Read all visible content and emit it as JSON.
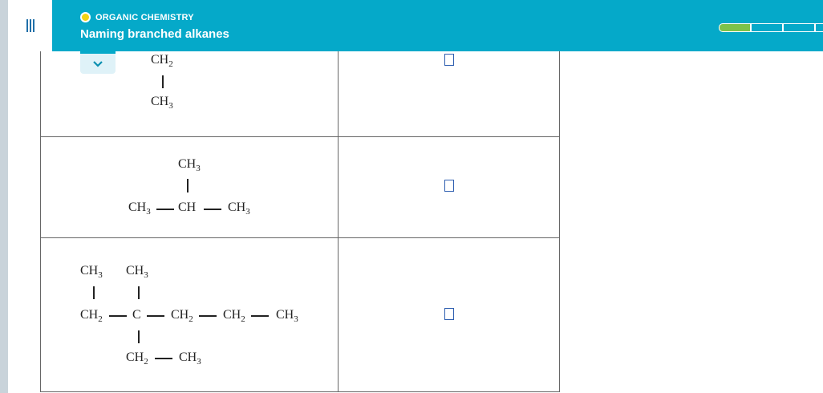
{
  "header": {
    "topic": "ORGANIC CHEMISTRY",
    "title": "Naming branched alkanes",
    "progress_segments_filled": 1,
    "progress_segments_total": 4
  },
  "rows": [
    {
      "fragment": {
        "top": "CH",
        "top_sub": "2",
        "bottom": "CH",
        "bottom_sub": "3"
      }
    },
    {
      "isobutane": {
        "top": "CH",
        "top_sub": "3",
        "left": "CH",
        "left_sub": "3",
        "center": "CH",
        "right": "CH",
        "right_sub": "3"
      }
    },
    {
      "branched": {
        "m1": "CH",
        "m1_sub": "3",
        "m2": "CH",
        "m2_sub": "3",
        "c1": "CH",
        "c1_sub": "2",
        "c2": "C",
        "c3": "CH",
        "c3_sub": "2",
        "c4": "CH",
        "c4_sub": "2",
        "c5": "CH",
        "c5_sub": "3",
        "e1": "CH",
        "e1_sub": "2",
        "e2": "CH",
        "e2_sub": "3"
      }
    }
  ],
  "colors": {
    "header": "#05a9c9",
    "topic_dot": "#f3d312",
    "progress_fill": "#7dc24a",
    "answer_box_border": "#2f5fb0"
  }
}
